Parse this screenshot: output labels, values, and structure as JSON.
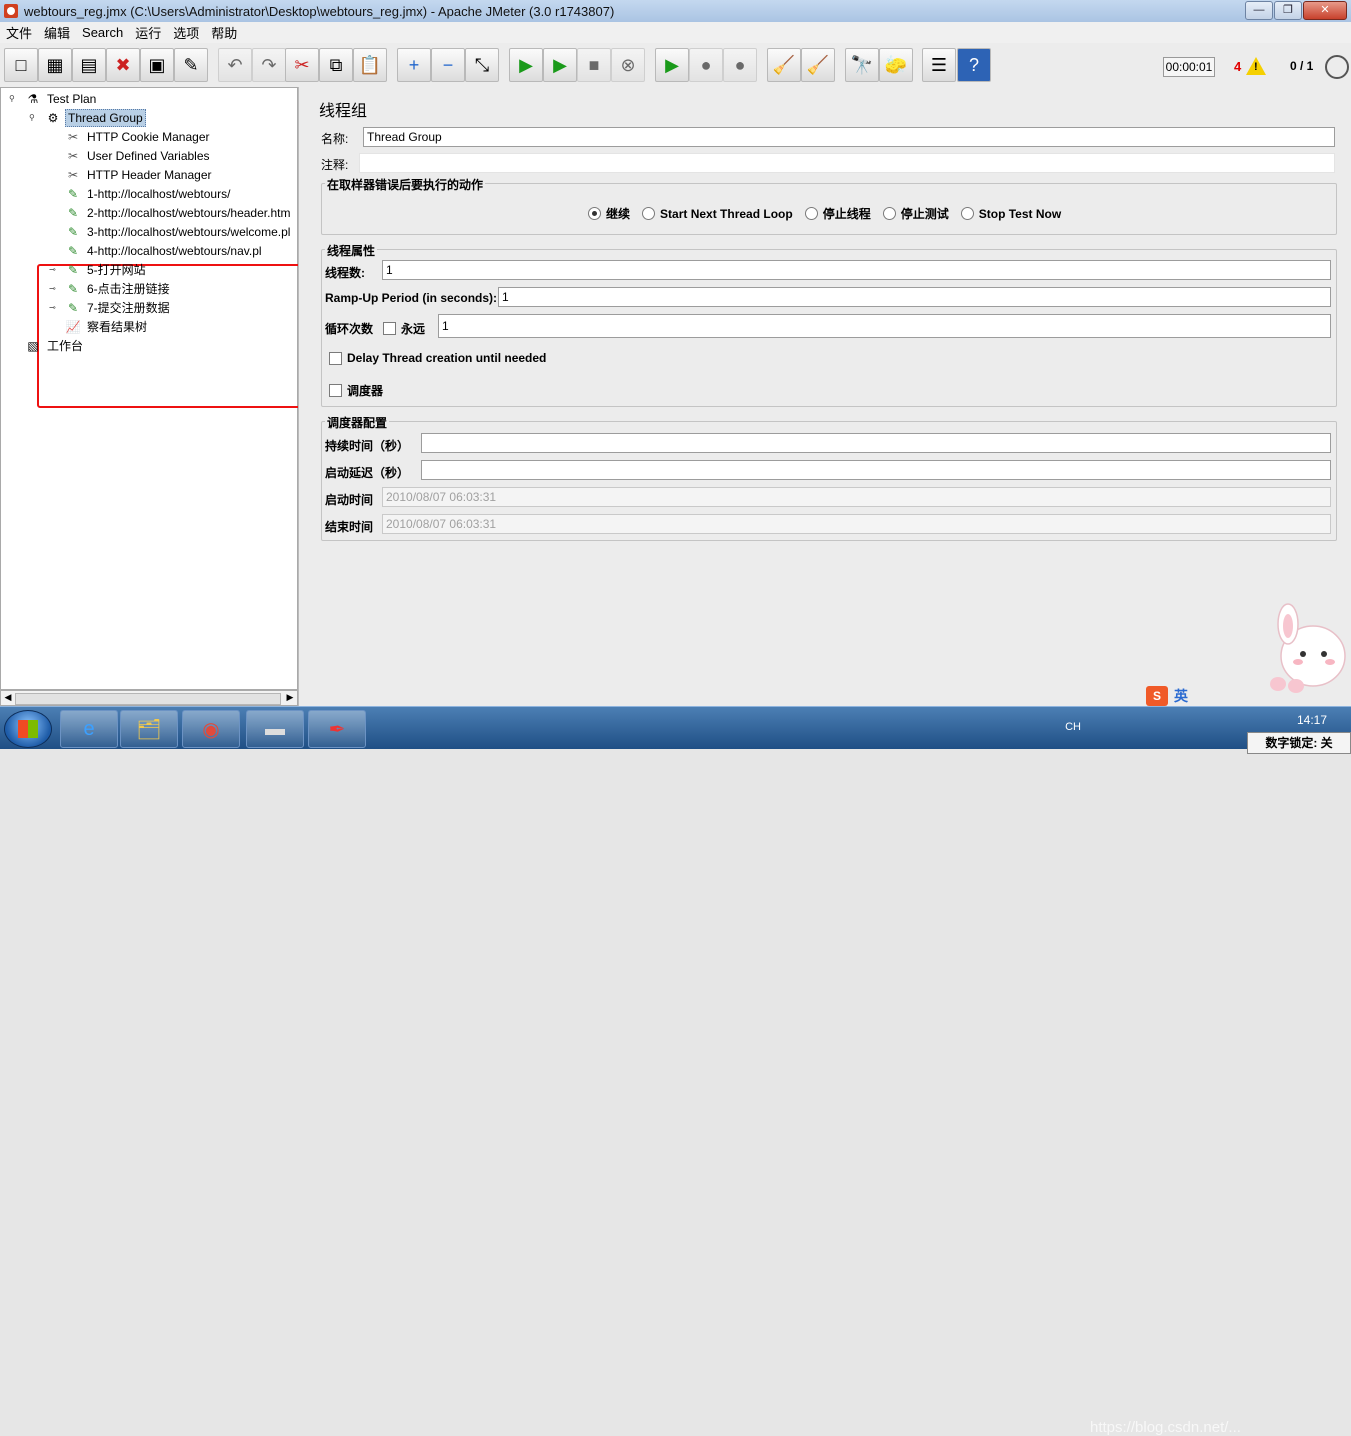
{
  "window": {
    "title": "webtours_reg.jmx (C:\\Users\\Administrator\\Desktop\\webtours_reg.jmx) - Apache JMeter (3.0 r1743807)",
    "controls": [
      "minimize",
      "maximize",
      "close"
    ]
  },
  "menu": [
    "文件",
    "编辑",
    "Search",
    "运行",
    "选项",
    "帮助"
  ],
  "toolbar": {
    "buttons": [
      {
        "name": "new-icon",
        "glyph": "□"
      },
      {
        "name": "templates-icon",
        "glyph": "▦"
      },
      {
        "name": "open-icon",
        "glyph": "▤"
      },
      {
        "name": "close-file-icon",
        "glyph": "✖"
      },
      {
        "name": "save-icon",
        "glyph": "▣"
      },
      {
        "name": "save-as-icon",
        "glyph": "✎"
      },
      {
        "name": "undo-icon",
        "glyph": "↶",
        "disabled": true
      },
      {
        "name": "redo-icon",
        "glyph": "↷",
        "disabled": true
      },
      {
        "name": "cut-icon",
        "glyph": "✂"
      },
      {
        "name": "copy-icon",
        "glyph": "⧉"
      },
      {
        "name": "paste-icon",
        "glyph": "📋"
      },
      {
        "name": "expand-icon",
        "glyph": "+"
      },
      {
        "name": "collapse-icon",
        "glyph": "−"
      },
      {
        "name": "toggle-icon",
        "glyph": "⤡"
      },
      {
        "name": "start-icon",
        "glyph": "▶"
      },
      {
        "name": "start-no-pause-icon",
        "glyph": "▶"
      },
      {
        "name": "stop-icon",
        "glyph": "■",
        "disabled": true
      },
      {
        "name": "shutdown-icon",
        "glyph": "⊗",
        "disabled": true
      },
      {
        "name": "remote-start-icon",
        "glyph": "▶"
      },
      {
        "name": "remote-stop-icon",
        "glyph": "●",
        "disabled": true
      },
      {
        "name": "remote-shutdown-icon",
        "glyph": "●",
        "disabled": true
      },
      {
        "name": "clear-icon",
        "glyph": "🧹"
      },
      {
        "name": "clear-all-icon",
        "glyph": "🧹"
      },
      {
        "name": "search-icon",
        "glyph": "🔭"
      },
      {
        "name": "reset-search-icon",
        "glyph": "🧽"
      },
      {
        "name": "function-helper-icon",
        "glyph": "☰"
      },
      {
        "name": "help-icon",
        "glyph": "?"
      }
    ],
    "timer": "00:00:01",
    "error_count": "4",
    "threads": "0 / 1"
  },
  "tree": [
    {
      "label": "Test Plan",
      "icon": "test-plan-icon",
      "glyph": "⚗",
      "level": 0,
      "expander": "expanded"
    },
    {
      "label": "Thread Group",
      "icon": "thread-group-icon",
      "glyph": "⚙",
      "level": 1,
      "expander": "expanded",
      "selected": true
    },
    {
      "label": "HTTP Cookie Manager",
      "icon": "config-tool-icon",
      "glyph": "✂",
      "level": 2
    },
    {
      "label": "User Defined Variables",
      "icon": "config-tool-icon",
      "glyph": "✂",
      "level": 2
    },
    {
      "label": "HTTP Header Manager",
      "icon": "config-tool-icon",
      "glyph": "✂",
      "level": 2
    },
    {
      "label": "1-http://localhost/webtours/",
      "icon": "sampler-icon",
      "glyph": "✎",
      "level": 2
    },
    {
      "label": "2-http://localhost/webtours/header.htm",
      "icon": "sampler-icon",
      "glyph": "✎",
      "level": 2
    },
    {
      "label": "3-http://localhost/webtours/welcome.pl",
      "icon": "sampler-icon",
      "glyph": "✎",
      "level": 2
    },
    {
      "label": "4-http://localhost/webtours/nav.pl",
      "icon": "sampler-icon",
      "glyph": "✎",
      "level": 2
    },
    {
      "label": "5-打开网站",
      "icon": "sampler-icon",
      "glyph": "✎",
      "level": 2,
      "expander": "collapsed"
    },
    {
      "label": "6-点击注册链接",
      "icon": "sampler-icon",
      "glyph": "✎",
      "level": 2,
      "expander": "collapsed"
    },
    {
      "label": "7-提交注册数据",
      "icon": "sampler-icon",
      "glyph": "✎",
      "level": 2,
      "expander": "collapsed"
    },
    {
      "label": "察看结果树",
      "icon": "listener-icon",
      "glyph": "📈",
      "level": 2
    },
    {
      "label": "工作台",
      "icon": "workbench-icon",
      "glyph": "▧",
      "level": 0
    }
  ],
  "panel": {
    "heading": "线程组",
    "name_label": "名称:",
    "name_value": "Thread Group",
    "comment_label": "注释:",
    "comment_value": "",
    "error_action": {
      "title": "在取样器错误后要执行的动作",
      "options": [
        {
          "label": "继续",
          "checked": true
        },
        {
          "label": "Start Next Thread Loop",
          "checked": false
        },
        {
          "label": "停止线程",
          "checked": false
        },
        {
          "label": "停止测试",
          "checked": false
        },
        {
          "label": "Stop Test Now",
          "checked": false
        }
      ]
    },
    "thread_props": {
      "title": "线程属性",
      "threads_label": "线程数:",
      "threads_value": "1",
      "rampup_label": "Ramp-Up Period (in seconds):",
      "rampup_value": "1",
      "loop_label": "循环次数",
      "forever_label": "永远",
      "loop_value": "1",
      "delay_label": "Delay Thread creation until needed",
      "scheduler_label": "调度器"
    },
    "scheduler": {
      "title": "调度器配置",
      "duration_label": "持续时间（秒）",
      "duration_value": "",
      "startup_delay_label": "启动延迟（秒）",
      "startup_delay_value": "",
      "start_time_label": "启动时间",
      "start_time_value": "2010/08/07 06:03:31",
      "end_time_label": "结束时间",
      "end_time_value": "2010/08/07 06:03:31"
    }
  },
  "taskbar": {
    "apps": [
      {
        "name": "ie-icon",
        "glyph": "e"
      },
      {
        "name": "explorer-icon",
        "glyph": "🗂"
      },
      {
        "name": "chrome-icon",
        "glyph": "◉"
      },
      {
        "name": "cmd-icon",
        "glyph": "▬"
      },
      {
        "name": "jmeter-icon",
        "glyph": "✒"
      }
    ],
    "lang": "CH",
    "clock": "14:17",
    "watermark": "https://blog.csdn.net/...",
    "numlock": "数字锁定: 关",
    "ime_s": "S",
    "ime_lang": "英"
  }
}
